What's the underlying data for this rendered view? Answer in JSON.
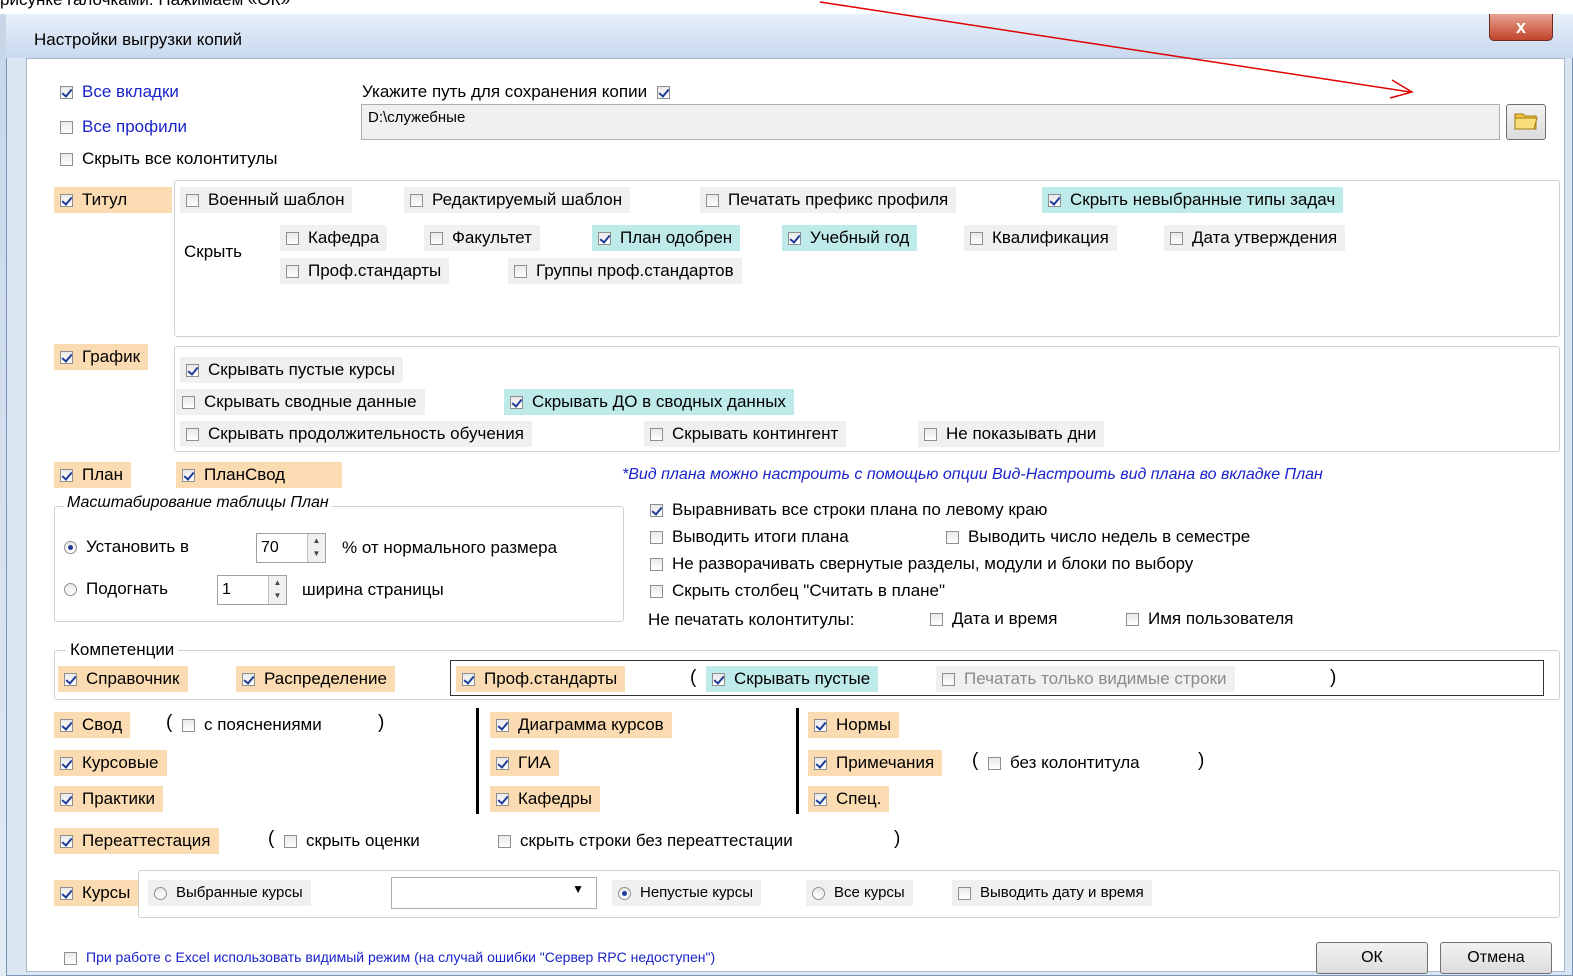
{
  "top_caption": "рисунке галочками. Нажимаем «ОК»",
  "window": {
    "title": "Настройки выгрузки копий",
    "close": "x"
  },
  "general": {
    "all_tabs": "Все вкладки",
    "all_profiles": "Все профили",
    "hide_headers": "Скрыть все колонтитулы",
    "path_label": "Укажите путь для сохранения копии",
    "path_value": "D:\\служебные"
  },
  "titul": {
    "label": "Титул",
    "military": "Военный шаблон",
    "editable": "Редактируемый шаблон",
    "prefix": "Печатать префикс профиля",
    "hide_unselected": "Скрыть невыбранные типы задач",
    "hide_label": "Скрыть",
    "department": "Кафедра",
    "faculty": "Факультет",
    "plan_approved": "План одобрен",
    "study_year": "Учебный год",
    "qualification": "Квалификация",
    "approval_date": "Дата утверждения",
    "prof_standards": "Проф.стандарты",
    "prof_groups": "Группы проф.стандартов"
  },
  "grafik": {
    "label": "График",
    "hide_empty": "Скрывать пустые курсы",
    "hide_summary": "Скрывать сводные данные",
    "hide_do": "Скрывать ДО в сводных данных",
    "hide_duration": "Скрывать продолжительность обучения",
    "hide_contingent": "Скрывать контингент",
    "no_days": "Не показывать дни"
  },
  "plan": {
    "label": "План",
    "plansvod": "ПланСвод",
    "note": "*Вид плана можно настроить с помощью опции Вид-Настроить вид плана во вкладке План",
    "scale_title": "Масштабирование таблицы План",
    "set_to": "Установить в",
    "set_value": "70",
    "percent": "% от нормального размера",
    "fit": "Подогнать",
    "fit_value": "1",
    "page_width": "ширина страницы",
    "align_left": "Выравнивать все строки плана по левому краю",
    "totals": "Выводить итоги плана",
    "weeks": "Выводить число недель в семестре",
    "no_expand": "Не разворачивать свернутые разделы, модули и блоки по выбору",
    "hide_column": "Скрыть столбец \"Считать в плане\"",
    "no_print_headers": "Не печатать колонтитулы:",
    "date_time": "Дата и время",
    "user_name": "Имя пользователя"
  },
  "competencies": {
    "title": "Компетенции",
    "reference": "Справочник",
    "distribution": "Распределение",
    "prof_standards": "Проф.стандарты",
    "open_paren": "(",
    "hide_empty": "Скрывать пустые",
    "print_visible": "Печатать только видимые строки",
    "close_paren": ")"
  },
  "reports": {
    "svod": "Свод",
    "with_notes": "с пояснениями",
    "paren_open": "(",
    "paren_close": ")",
    "coursework": "Курсовые",
    "practice": "Практики",
    "course_chart": "Диаграмма курсов",
    "gia": "ГИА",
    "departments": "Кафедры",
    "norms": "Нормы",
    "notes": "Примечания",
    "no_header": "без колонтитула",
    "spec": "Спец."
  },
  "reattest": {
    "label": "Переаттестация",
    "hide_grades": "скрыть оценки",
    "hide_rows": "скрыть строки без переаттестации",
    "paren_open": "(",
    "paren_close": ")"
  },
  "courses": {
    "label": "Курсы",
    "selected": "Выбранные курсы",
    "nonempty": "Непустые курсы",
    "all": "Все курсы",
    "date_time": "Выводить дату и время"
  },
  "footer": {
    "excel_visible": "При работе с Excel использовать видимый режим (на случай ошибки \"Сервер RPC недоступен\")",
    "ok": "ОК",
    "cancel": "Отмена"
  },
  "colors": {
    "accent_orange": "#fbdcb2",
    "accent_cyan": "#bfeaea",
    "link_blue": "#1a23c9",
    "arrow_red": "#e00000"
  }
}
